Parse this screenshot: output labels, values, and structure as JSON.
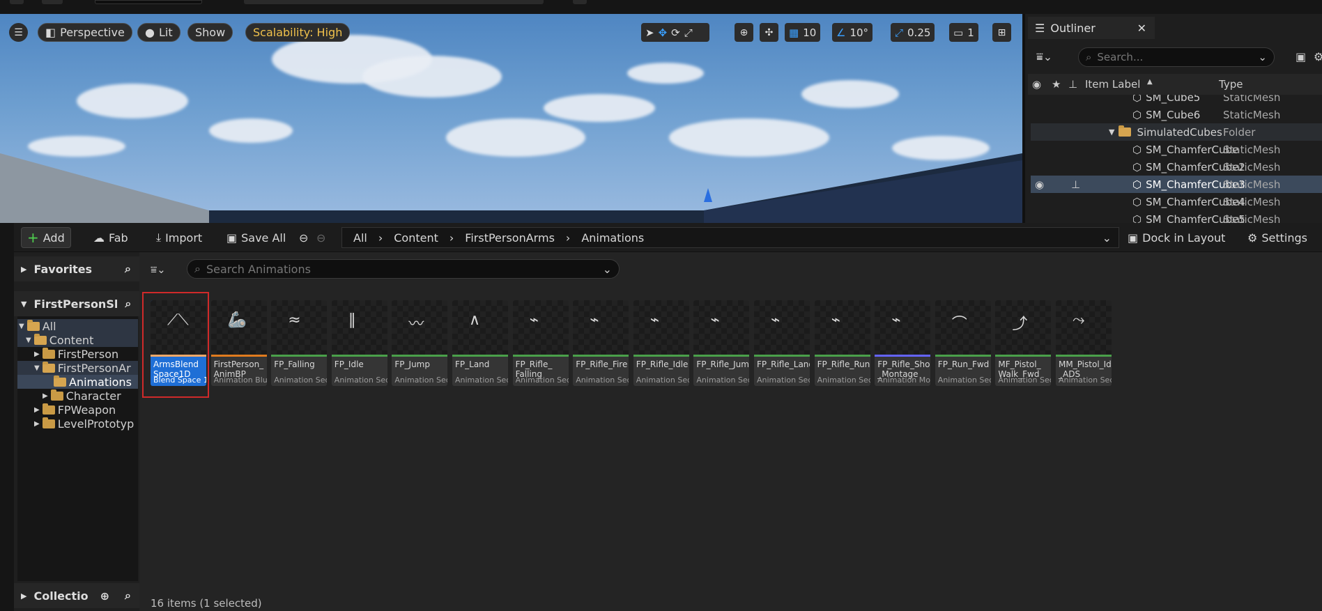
{
  "viewport": {
    "view_mode": "Perspective",
    "lighting": "Lit",
    "show": "Show",
    "scalability": "Scalability: High",
    "grid_snap": "10",
    "rotation_snap": "10°",
    "scale_snap": "0.25",
    "camera_speed": "1"
  },
  "outliner": {
    "title": "Outliner",
    "search_placeholder": "Search...",
    "col_label": "Item Label",
    "col_type": "Type",
    "rows": [
      {
        "label": "SM_Cube5",
        "type": "StaticMesh"
      },
      {
        "label": "SM_Cube6",
        "type": "StaticMesh"
      },
      {
        "label": "SimulatedCubes",
        "type": "Folder"
      },
      {
        "label": "SM_ChamferCube",
        "type": "StaticMesh"
      },
      {
        "label": "SM_ChamferCube2",
        "type": "StaticMesh"
      },
      {
        "label": "SM_ChamferCube3",
        "type": "StaticMesh"
      },
      {
        "label": "SM_ChamferCube4",
        "type": "StaticMesh"
      },
      {
        "label": "SM_ChamferCube5",
        "type": "StaticMesh"
      }
    ]
  },
  "content_browser": {
    "toolbar": {
      "add": "Add",
      "fab": "Fab",
      "import": "Import",
      "save_all": "Save All",
      "dock": "Dock in Layout",
      "settings": "Settings"
    },
    "breadcrumb": [
      "All",
      "Content",
      "FirstPersonArms",
      "Animations"
    ],
    "favorites": "Favorites",
    "project_header": "FirstPersonSl",
    "collections": "Collectio",
    "tree": [
      {
        "label": "All"
      },
      {
        "label": "Content"
      },
      {
        "label": "FirstPerson"
      },
      {
        "label": "FirstPersonAr"
      },
      {
        "label": "Animations"
      },
      {
        "label": "Character"
      },
      {
        "label": "FPWeapon"
      },
      {
        "label": "LevelPrototyp"
      }
    ],
    "search_placeholder": "Search Animations",
    "assets": [
      {
        "name": "ArmsBlend\nSpace1D",
        "type": "Blend Space 1D",
        "color": "#f0a868"
      },
      {
        "name": "FirstPerson_\nAnimBP",
        "type": "Animation Blu...",
        "color": "#e07b1e"
      },
      {
        "name": "FP_Falling",
        "type": "Animation Seq...",
        "color": "#4aa04a"
      },
      {
        "name": "FP_Idle",
        "type": "Animation Seq...",
        "color": "#4aa04a"
      },
      {
        "name": "FP_Jump",
        "type": "Animation Seq...",
        "color": "#4aa04a"
      },
      {
        "name": "FP_Land",
        "type": "Animation Seq...",
        "color": "#4aa04a"
      },
      {
        "name": "FP_Rifle_\nFalling",
        "type": "Animation Seq...",
        "color": "#4aa04a"
      },
      {
        "name": "FP_Rifle_Fire",
        "type": "Animation Seq...",
        "color": "#4aa04a"
      },
      {
        "name": "FP_Rifle_Idle",
        "type": "Animation Seq...",
        "color": "#4aa04a"
      },
      {
        "name": "FP_Rifle_Jump",
        "type": "Animation Seq...",
        "color": "#4aa04a"
      },
      {
        "name": "FP_Rifle_Land",
        "type": "Animation Seq...",
        "color": "#4aa04a"
      },
      {
        "name": "FP_Rifle_Run",
        "type": "Animation Seq...",
        "color": "#4aa04a"
      },
      {
        "name": "FP_Rifle_Shoot\n_Montage",
        "type": "Animation Mo...",
        "color": "#6464ff"
      },
      {
        "name": "FP_Run_Fwd",
        "type": "Animation Seq...",
        "color": "#4aa04a"
      },
      {
        "name": "MF_Pistol_\nWalk_Fwd",
        "type": "Animation Seq...",
        "color": "#4aa04a"
      },
      {
        "name": "MM_Pistol_Idle\n_ADS",
        "type": "Animation Seq...",
        "color": "#4aa04a"
      }
    ],
    "status": "16 items (1 selected)"
  }
}
